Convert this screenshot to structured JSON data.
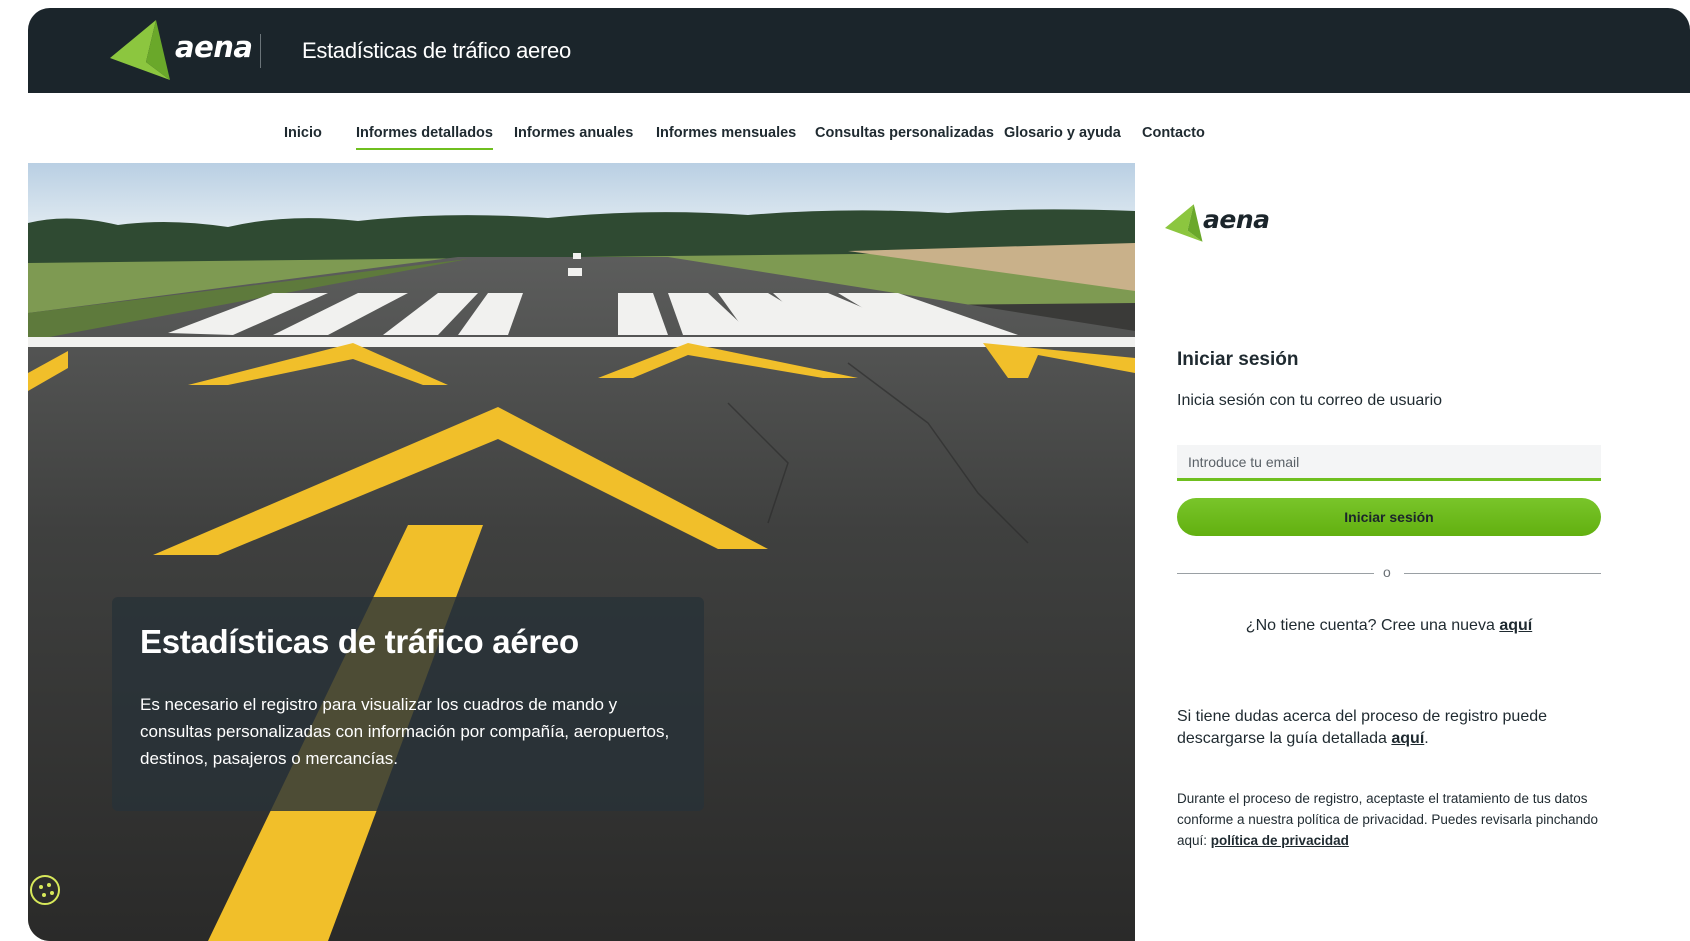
{
  "header": {
    "logo_text": "aena",
    "title": "Estadísticas de tráfico aereo"
  },
  "nav": {
    "items": [
      {
        "label": "Inicio"
      },
      {
        "label": "Informes detallados",
        "active": true
      },
      {
        "label": "Informes anuales"
      },
      {
        "label": "Informes mensuales"
      },
      {
        "label": "Consultas personalizadas"
      },
      {
        "label": "Glosario y ayuda"
      },
      {
        "label": "Contacto"
      }
    ]
  },
  "hero": {
    "title": "Estadísticas de tráfico aéreo",
    "text": "Es necesario el registro para visualizar los cuadros de mando y consultas personalizadas con información por compañía, aeropuertos, destinos, pasajeros o mercancías."
  },
  "login": {
    "logo_text": "aena",
    "title": "Iniciar sesión",
    "subtitle": "Inicia sesión con tu correo de usuario",
    "email_placeholder": "Introduce tu email",
    "email_value": "",
    "button_label": "Iniciar sesión",
    "divider_text": "o",
    "no_account_text": "¿No tiene cuenta? Cree una nueva",
    "no_account_link": "aquí",
    "help_text": "Si tiene dudas acerca del proceso de registro puede descargarse la guía detallada",
    "help_link": "aquí",
    "help_suffix": ".",
    "privacy_text": "Durante el proceso de registro, aceptaste el tratamiento de tus datos conforme a nuestra política de privacidad. Puedes revisarla pinchando aquí:",
    "privacy_link": "política de privacidad"
  },
  "colors": {
    "brand_green": "#6fbf1f",
    "header_bg": "#1b252b",
    "text_dark": "#1f2a30"
  },
  "icons": {
    "logo": "aena-arrow-logo",
    "cookie": "cookie-icon"
  }
}
